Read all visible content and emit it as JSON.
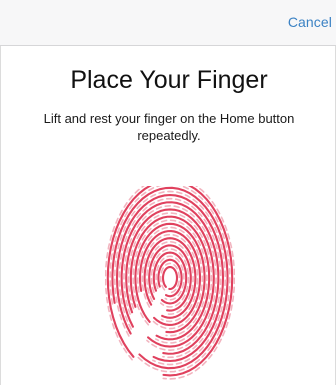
{
  "nav": {
    "cancel_label": "Cancel"
  },
  "main": {
    "title": "Place Your Finger",
    "instruction": "Lift and rest your finger on the Home button repeatedly."
  },
  "fingerprint": {
    "icon": "fingerprint-icon",
    "color": "#e0415e",
    "color_light": "#f2b5c0"
  }
}
